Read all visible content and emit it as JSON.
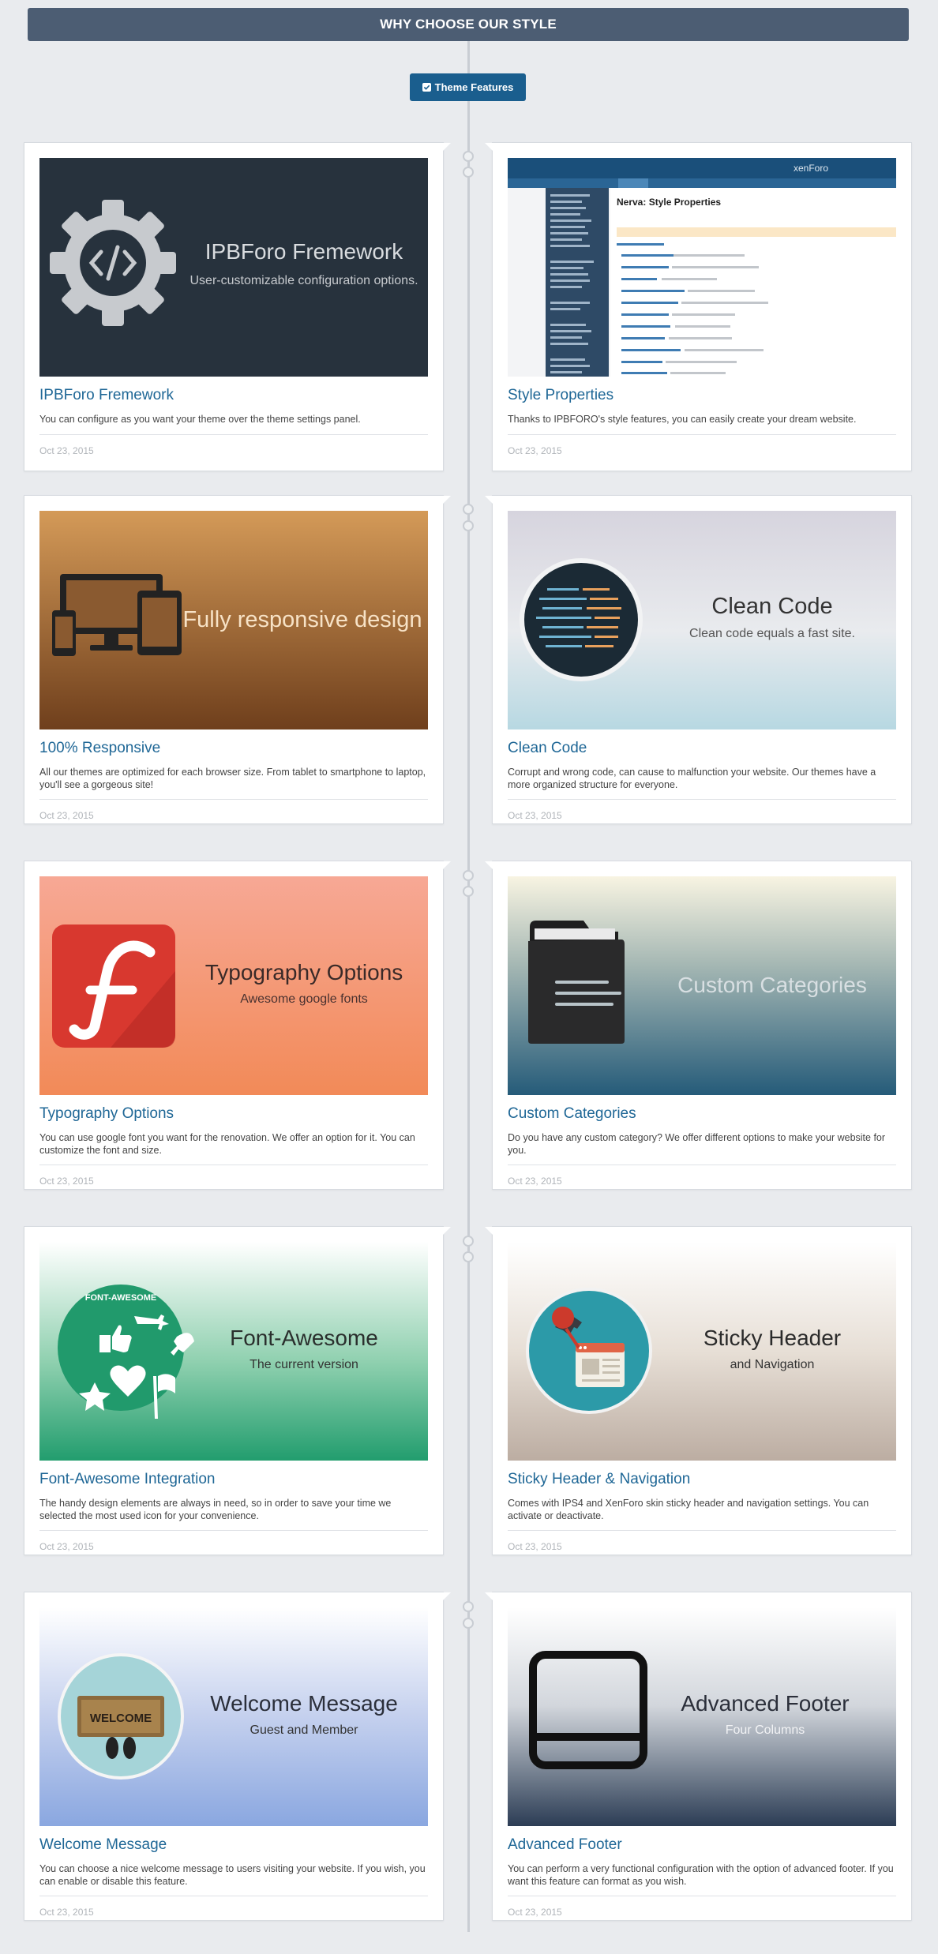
{
  "header": {
    "title": "WHY CHOOSE OUR STYLE"
  },
  "filter": {
    "label": "Theme Features"
  },
  "cards": [
    {
      "title": "IPBForo Fremework",
      "description": "You can configure as you want your theme over the theme settings panel.",
      "date": "Oct 23, 2015",
      "image_title": "IPBForo Fremework",
      "image_subtitle": "User-customizable configuration options."
    },
    {
      "title": "Style Properties",
      "description": "Thanks to IPBFORO's style features, you can easily create your dream website.",
      "date": "Oct 23, 2015",
      "image_title": "Nerva: Style Properties",
      "image_subtitle": "xenForo"
    },
    {
      "title": "100% Responsive",
      "description": "All our themes are optimized for each browser size. From tablet to smartphone to laptop, you'll see a gorgeous site!",
      "date": "Oct 23, 2015",
      "image_title": "Fully responsive design",
      "image_subtitle": ""
    },
    {
      "title": "Clean Code",
      "description": "Corrupt and wrong code, can cause to malfunction your website. Our themes have a more organized structure for everyone.",
      "date": "Oct 23, 2015",
      "image_title": "Clean Code",
      "image_subtitle": "Clean code equals a fast site."
    },
    {
      "title": "Typography Options",
      "description": "You can use google font you want for the renovation. We offer an option for it. You can customize the font and size.",
      "date": "Oct 23, 2015",
      "image_title": "Typography Options",
      "image_subtitle": "Awesome google fonts"
    },
    {
      "title": "Custom Categories",
      "description": "Do you have any custom category? We offer different options to make your website for you.",
      "date": "Oct 23, 2015",
      "image_title": "Custom Categories",
      "image_subtitle": ""
    },
    {
      "title": "Font-Awesome Integration",
      "description": "The handy design elements are always in need, so in order to save your time we selected the most used icon for your convenience.",
      "date": "Oct 23, 2015",
      "image_title": "Font-Awesome",
      "image_subtitle": "The current version",
      "image_badge": "FONT-AWESOME"
    },
    {
      "title": "Sticky Header & Navigation",
      "description": "Comes with IPS4 and XenForo skin sticky header and navigation settings. You can activate or deactivate.",
      "date": "Oct 23, 2015",
      "image_title": "Sticky Header",
      "image_subtitle": "and Navigation"
    },
    {
      "title": "Welcome Message",
      "description": "You can choose a nice welcome message to users visiting your website. If you wish, you can enable or disable this feature.",
      "date": "Oct 23, 2015",
      "image_title": "Welcome Message",
      "image_subtitle": "Guest and Member",
      "image_badge": "WELCOME"
    },
    {
      "title": "Advanced Footer",
      "description": "You can perform a very functional configuration with the option of advanced footer. If you want this feature can format as you wish.",
      "date": "Oct 23, 2015",
      "image_title": "Advanced Footer",
      "image_subtitle": "Four Columns"
    }
  ],
  "colors": {
    "header_bg": "#4c5d73",
    "accent": "#1a5e8e",
    "title_link": "#1f6796"
  },
  "icons": [
    "check-icon",
    "gear-code-icon",
    "devices-icon",
    "code-circle-icon",
    "typography-f-icon",
    "folder-icon",
    "font-awesome-icon",
    "pin-browser-icon",
    "welcome-mat-icon",
    "footer-window-icon"
  ]
}
